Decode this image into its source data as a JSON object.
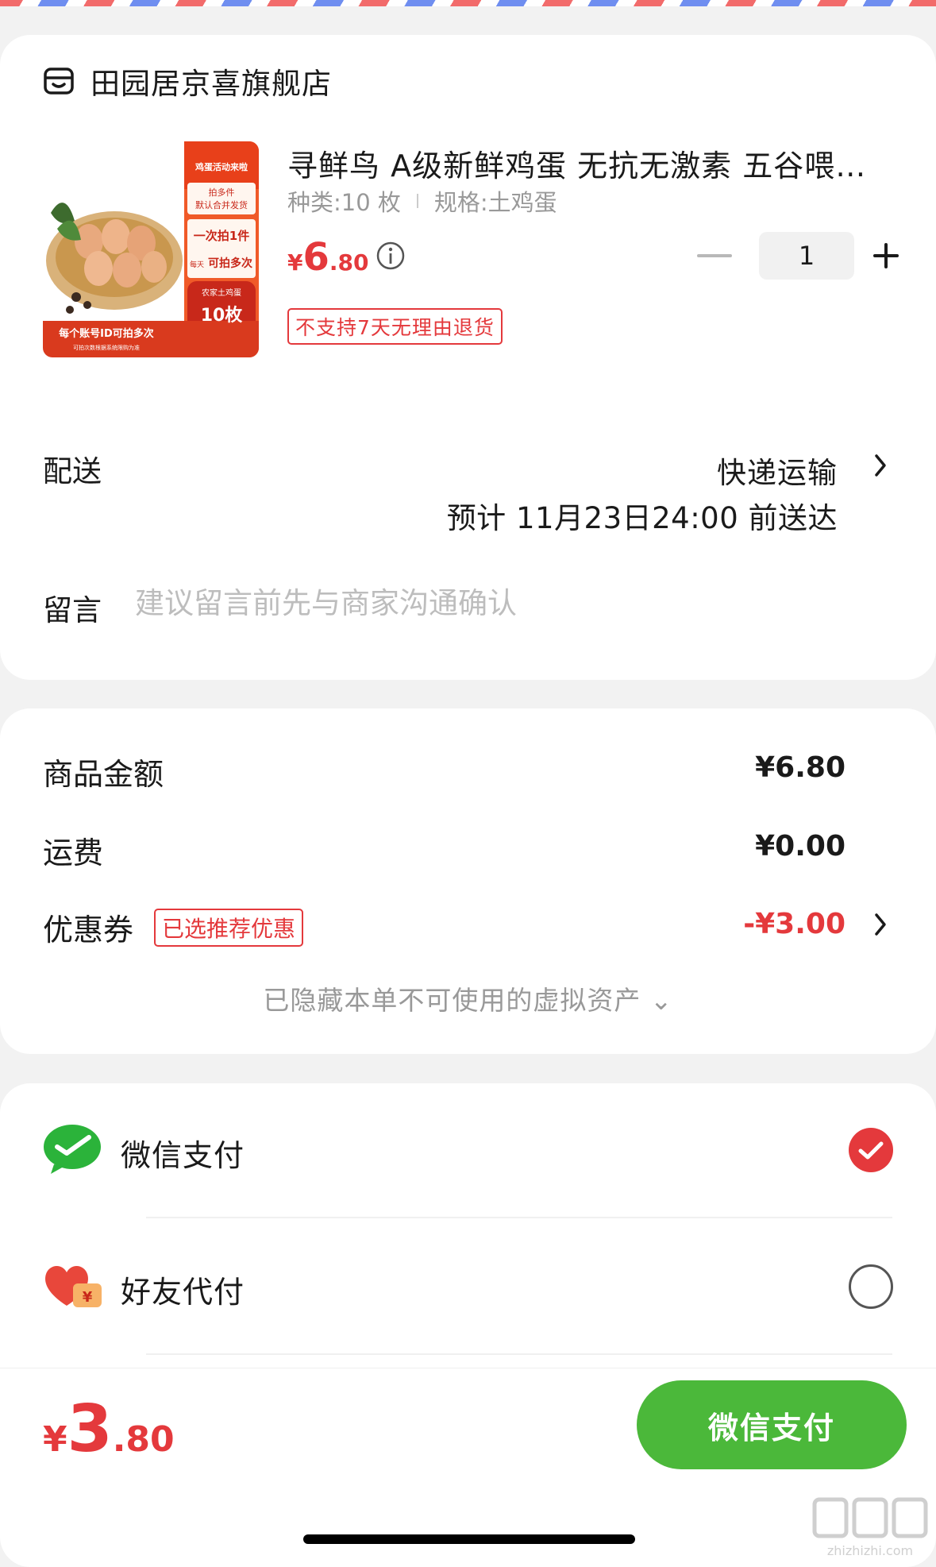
{
  "store": {
    "name": "田园居京喜旗舰店"
  },
  "product": {
    "title": "寻鲜鸟 A级新鲜鸡蛋 无抗无激素 五谷喂…",
    "spec_type": "种类:10 枚",
    "spec_size": "规格:土鸡蛋",
    "price_currency": "¥",
    "price_int": "6",
    "price_dec": ".80",
    "quantity": "1",
    "no_return_tag": "不支持7天无理由退货",
    "image_texts": {
      "banner": "鸡蛋活动来啦",
      "line1": "拍多件",
      "line2": "默认合并发货",
      "once": "一次拍1件",
      "daily_prefix": "每天",
      "daily": "可拍多次",
      "farm": "农家土鸡蛋",
      "count": "10枚",
      "footer": "每个账号ID可拍多次",
      "footer_small": "可拍次数根据系统限购为准"
    }
  },
  "delivery": {
    "label": "配送",
    "method": "快递运输",
    "eta": "预计 11月23日24:00 前送达"
  },
  "message": {
    "label": "留言",
    "placeholder": "建议留言前先与商家沟通确认"
  },
  "summary": {
    "goods_label": "商品金额",
    "goods_value": "¥6.80",
    "shipping_label": "运费",
    "shipping_value": "¥0.00",
    "coupon_label": "优惠券",
    "coupon_badge": "已选推荐优惠",
    "coupon_value": "-¥3.00",
    "hidden_assets": "已隐藏本单不可使用的虚拟资产 ⌄"
  },
  "payment": {
    "options": [
      {
        "label": "微信支付",
        "icon": "wechat-pay-icon",
        "selected": true
      },
      {
        "label": "好友代付",
        "icon": "friend-pay-icon",
        "selected": false
      }
    ]
  },
  "footer": {
    "total_currency": "¥",
    "total_int": "3",
    "total_dec": ".80",
    "pay_button": "微信支付"
  },
  "watermark": "值 什么值得买 zhizhizhi.com",
  "colors": {
    "accent_red": "#e4393c",
    "wechat_green": "#4bb83a"
  }
}
